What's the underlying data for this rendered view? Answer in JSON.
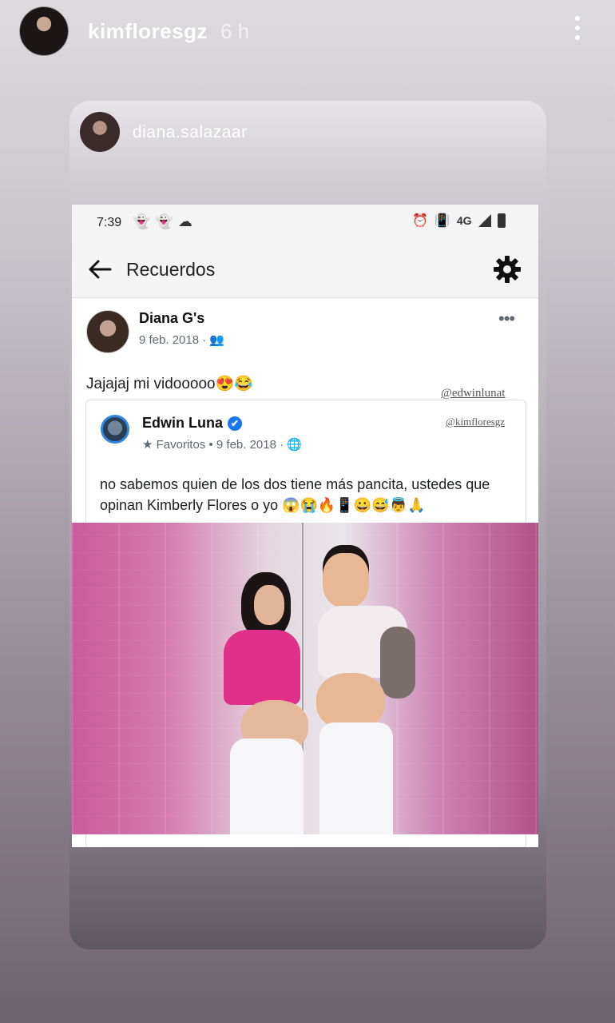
{
  "story": {
    "username": "kimfloresgz",
    "time": "6 h",
    "mention_username": "diana.salazaar"
  },
  "screenshot": {
    "status_time": "7:39",
    "status_left_icons": "👻👻☁",
    "network": "4G",
    "header_title": "Recuerdos",
    "post": {
      "author": "Diana G's",
      "date": "9 feb. 2018 · 👥",
      "more": "•••",
      "text": "Jajajaj mi vidooooo😍😂"
    },
    "watermark_1": "@edwinlunat",
    "watermark_2": "@kimfloresgz",
    "shared_post": {
      "author": "Edwin Luna",
      "verified_mark": "✔",
      "meta": "★ Favoritos • 9 feb. 2018 · 🌐",
      "text": "no sabemos quien de los dos tiene más pancita, ustedes que opinan Kimberly Flores o yo 😱😭🔥📱😀😅👼🙏"
    }
  },
  "colors": {
    "verified_blue": "#1877f2",
    "photo_pink": "#d67aaf"
  }
}
